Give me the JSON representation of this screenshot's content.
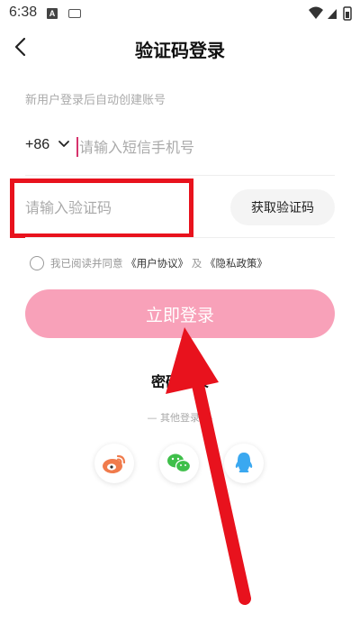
{
  "status_bar": {
    "time": "6:38",
    "app_icon_letter": "A"
  },
  "header": {
    "title": "验证码登录"
  },
  "hint": "新用户登录后自动创建账号",
  "phone": {
    "country_code": "+86",
    "placeholder": "请输入短信手机号"
  },
  "code": {
    "placeholder": "请输入验证码",
    "get_code_label": "获取验证码"
  },
  "agreement": {
    "prefix": "我已阅读并同意",
    "user_agreement": "《用户协议》",
    "and": "及",
    "privacy_policy": "《隐私政策》"
  },
  "login_button": "立即登录",
  "password_login": "密码登录",
  "other_login": "— 其他登录 —",
  "social": [
    "weibo-icon",
    "wechat-icon",
    "qq-icon"
  ],
  "colors": {
    "accent": "#f8a1b9",
    "highlight": "#e8121d"
  }
}
